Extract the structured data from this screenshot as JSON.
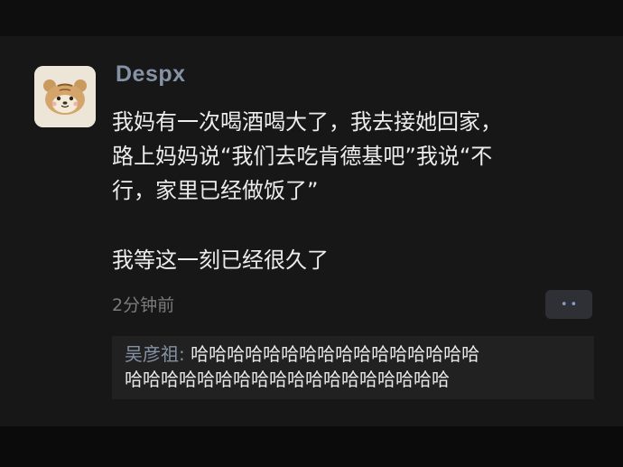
{
  "post": {
    "username": "Despx",
    "lines": [
      "我妈有一次喝酒喝大了，我去接她回家，",
      "路上妈妈说“我们去吃肯德基吧”我说“不",
      "行，家里已经做饭了”",
      "我等这一刻已经很久了"
    ],
    "timestamp": "2分钟前",
    "more_label": "••",
    "avatar_icon": "cartoon-bear-avatar-icon"
  },
  "comment": {
    "author": "吴彦祖",
    "separator": ": ",
    "text_line1": "哈哈哈哈哈哈哈哈哈哈哈哈哈哈哈哈",
    "text_line2": "哈哈哈哈哈哈哈哈哈哈哈哈哈哈哈哈哈哈"
  },
  "colors": {
    "background": "#171717",
    "username": "#8592a5",
    "text": "#ececec",
    "comment_bg": "#212121"
  }
}
